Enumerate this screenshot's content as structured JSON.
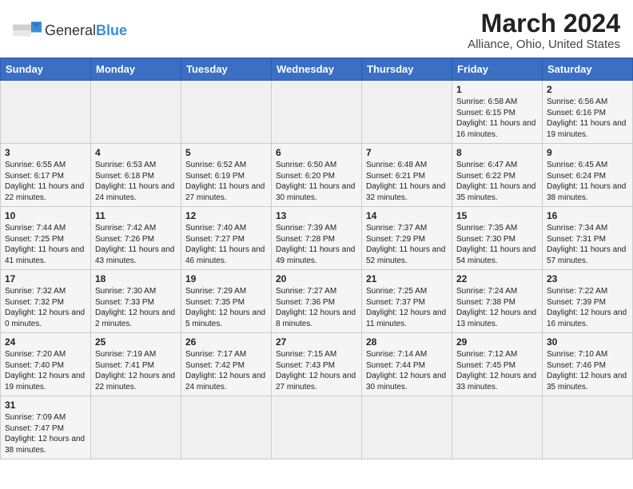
{
  "header": {
    "logo_general": "General",
    "logo_blue": "Blue",
    "month_title": "March 2024",
    "location": "Alliance, Ohio, United States"
  },
  "weekdays": [
    "Sunday",
    "Monday",
    "Tuesday",
    "Wednesday",
    "Thursday",
    "Friday",
    "Saturday"
  ],
  "days": [
    {
      "num": "",
      "info": ""
    },
    {
      "num": "",
      "info": ""
    },
    {
      "num": "",
      "info": ""
    },
    {
      "num": "",
      "info": ""
    },
    {
      "num": "",
      "info": ""
    },
    {
      "num": "1",
      "info": "Sunrise: 6:58 AM\nSunset: 6:15 PM\nDaylight: 11 hours and 16 minutes."
    },
    {
      "num": "2",
      "info": "Sunrise: 6:56 AM\nSunset: 6:16 PM\nDaylight: 11 hours and 19 minutes."
    },
    {
      "num": "3",
      "info": "Sunrise: 6:55 AM\nSunset: 6:17 PM\nDaylight: 11 hours and 22 minutes."
    },
    {
      "num": "4",
      "info": "Sunrise: 6:53 AM\nSunset: 6:18 PM\nDaylight: 11 hours and 24 minutes."
    },
    {
      "num": "5",
      "info": "Sunrise: 6:52 AM\nSunset: 6:19 PM\nDaylight: 11 hours and 27 minutes."
    },
    {
      "num": "6",
      "info": "Sunrise: 6:50 AM\nSunset: 6:20 PM\nDaylight: 11 hours and 30 minutes."
    },
    {
      "num": "7",
      "info": "Sunrise: 6:48 AM\nSunset: 6:21 PM\nDaylight: 11 hours and 32 minutes."
    },
    {
      "num": "8",
      "info": "Sunrise: 6:47 AM\nSunset: 6:22 PM\nDaylight: 11 hours and 35 minutes."
    },
    {
      "num": "9",
      "info": "Sunrise: 6:45 AM\nSunset: 6:24 PM\nDaylight: 11 hours and 38 minutes."
    },
    {
      "num": "10",
      "info": "Sunrise: 7:44 AM\nSunset: 7:25 PM\nDaylight: 11 hours and 41 minutes."
    },
    {
      "num": "11",
      "info": "Sunrise: 7:42 AM\nSunset: 7:26 PM\nDaylight: 11 hours and 43 minutes."
    },
    {
      "num": "12",
      "info": "Sunrise: 7:40 AM\nSunset: 7:27 PM\nDaylight: 11 hours and 46 minutes."
    },
    {
      "num": "13",
      "info": "Sunrise: 7:39 AM\nSunset: 7:28 PM\nDaylight: 11 hours and 49 minutes."
    },
    {
      "num": "14",
      "info": "Sunrise: 7:37 AM\nSunset: 7:29 PM\nDaylight: 11 hours and 52 minutes."
    },
    {
      "num": "15",
      "info": "Sunrise: 7:35 AM\nSunset: 7:30 PM\nDaylight: 11 hours and 54 minutes."
    },
    {
      "num": "16",
      "info": "Sunrise: 7:34 AM\nSunset: 7:31 PM\nDaylight: 11 hours and 57 minutes."
    },
    {
      "num": "17",
      "info": "Sunrise: 7:32 AM\nSunset: 7:32 PM\nDaylight: 12 hours and 0 minutes."
    },
    {
      "num": "18",
      "info": "Sunrise: 7:30 AM\nSunset: 7:33 PM\nDaylight: 12 hours and 2 minutes."
    },
    {
      "num": "19",
      "info": "Sunrise: 7:29 AM\nSunset: 7:35 PM\nDaylight: 12 hours and 5 minutes."
    },
    {
      "num": "20",
      "info": "Sunrise: 7:27 AM\nSunset: 7:36 PM\nDaylight: 12 hours and 8 minutes."
    },
    {
      "num": "21",
      "info": "Sunrise: 7:25 AM\nSunset: 7:37 PM\nDaylight: 12 hours and 11 minutes."
    },
    {
      "num": "22",
      "info": "Sunrise: 7:24 AM\nSunset: 7:38 PM\nDaylight: 12 hours and 13 minutes."
    },
    {
      "num": "23",
      "info": "Sunrise: 7:22 AM\nSunset: 7:39 PM\nDaylight: 12 hours and 16 minutes."
    },
    {
      "num": "24",
      "info": "Sunrise: 7:20 AM\nSunset: 7:40 PM\nDaylight: 12 hours and 19 minutes."
    },
    {
      "num": "25",
      "info": "Sunrise: 7:19 AM\nSunset: 7:41 PM\nDaylight: 12 hours and 22 minutes."
    },
    {
      "num": "26",
      "info": "Sunrise: 7:17 AM\nSunset: 7:42 PM\nDaylight: 12 hours and 24 minutes."
    },
    {
      "num": "27",
      "info": "Sunrise: 7:15 AM\nSunset: 7:43 PM\nDaylight: 12 hours and 27 minutes."
    },
    {
      "num": "28",
      "info": "Sunrise: 7:14 AM\nSunset: 7:44 PM\nDaylight: 12 hours and 30 minutes."
    },
    {
      "num": "29",
      "info": "Sunrise: 7:12 AM\nSunset: 7:45 PM\nDaylight: 12 hours and 33 minutes."
    },
    {
      "num": "30",
      "info": "Sunrise: 7:10 AM\nSunset: 7:46 PM\nDaylight: 12 hours and 35 minutes."
    },
    {
      "num": "31",
      "info": "Sunrise: 7:09 AM\nSunset: 7:47 PM\nDaylight: 12 hours and 38 minutes."
    }
  ]
}
